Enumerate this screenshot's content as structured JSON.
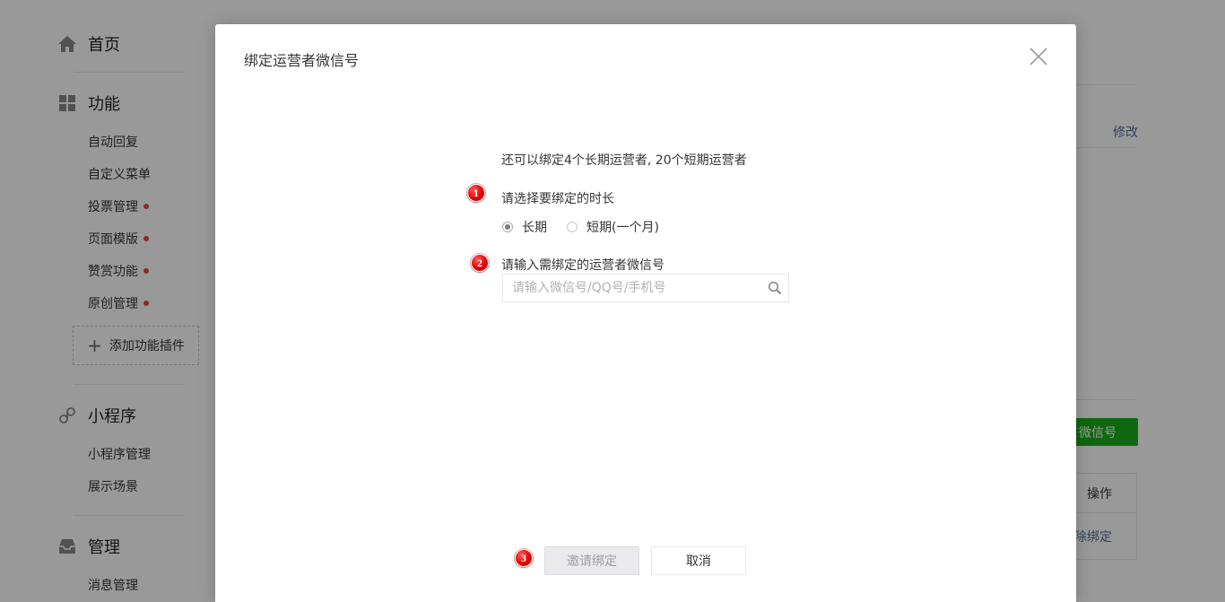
{
  "sidebar": {
    "home": {
      "label": "首页",
      "icon": "home-icon"
    },
    "features": {
      "label": "功能",
      "icon": "grid-icon",
      "items": [
        {
          "label": "自动回复",
          "new": false
        },
        {
          "label": "自定义菜单",
          "new": false
        },
        {
          "label": "投票管理",
          "new": true
        },
        {
          "label": "页面模版",
          "new": true
        },
        {
          "label": "赞赏功能",
          "new": true
        },
        {
          "label": "原创管理",
          "new": true
        }
      ],
      "add_plugin_label": "添加功能插件"
    },
    "mini_program": {
      "label": "小程序",
      "icon": "link-icon",
      "items": [
        {
          "label": "小程序管理"
        },
        {
          "label": "展示场景"
        }
      ]
    },
    "management": {
      "label": "管理",
      "icon": "inbox-icon",
      "items": [
        {
          "label": "消息管理"
        }
      ]
    }
  },
  "background": {
    "modify_link": "修改",
    "bind_button": "微信号",
    "table_header": "操作",
    "table_action": "除绑定"
  },
  "dialog": {
    "title": "绑定运营者微信号",
    "quota_text": "还可以绑定4个长期运营者, 20个短期运营者",
    "step1": {
      "number": "1",
      "label": "请选择要绑定的时长"
    },
    "duration_options": [
      {
        "label": "长期",
        "checked": true
      },
      {
        "label": "短期(一个月)",
        "checked": false
      }
    ],
    "step2": {
      "number": "2",
      "label": "请输入需绑定的运营者微信号"
    },
    "search": {
      "value": "",
      "placeholder": "请输入微信号/QQ号/手机号"
    },
    "step3": {
      "number": "3"
    },
    "invite_button": "邀请绑定",
    "cancel_button": "取消"
  },
  "colors": {
    "overlay": "rgba(0,0,0,0.4)",
    "badge": "#e60000",
    "accent_green": "#1aad19",
    "link": "#576b95",
    "new_dot": "#e64340"
  }
}
